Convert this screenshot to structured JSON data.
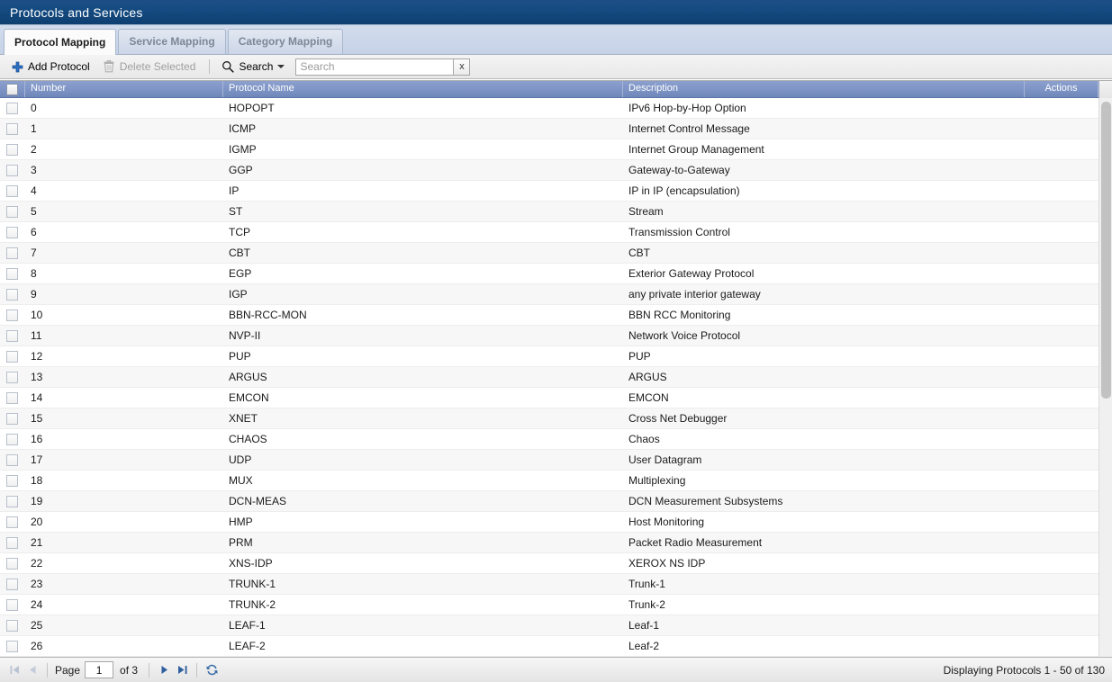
{
  "window": {
    "title": "Protocols and Services"
  },
  "tabs": [
    {
      "label": "Protocol Mapping",
      "active": true
    },
    {
      "label": "Service Mapping",
      "active": false
    },
    {
      "label": "Category Mapping",
      "active": false
    }
  ],
  "toolbar": {
    "add_label": "Add Protocol",
    "add_icon": "plus-icon",
    "delete_label": "Delete Selected",
    "delete_icon": "trash-icon",
    "delete_disabled": true,
    "search_menu_label": "Search",
    "search_menu_icon": "magnifier-icon",
    "search_value": "",
    "search_placeholder": "Search",
    "clear_label": "x"
  },
  "grid": {
    "columns": [
      "Number",
      "Protocol Name",
      "Description",
      "Actions"
    ],
    "rows": [
      {
        "number": "0",
        "name": "HOPOPT",
        "description": "IPv6 Hop-by-Hop Option"
      },
      {
        "number": "1",
        "name": "ICMP",
        "description": "Internet Control Message"
      },
      {
        "number": "2",
        "name": "IGMP",
        "description": "Internet Group Management"
      },
      {
        "number": "3",
        "name": "GGP",
        "description": "Gateway-to-Gateway"
      },
      {
        "number": "4",
        "name": "IP",
        "description": "IP in IP (encapsulation)"
      },
      {
        "number": "5",
        "name": "ST",
        "description": "Stream"
      },
      {
        "number": "6",
        "name": "TCP",
        "description": "Transmission Control"
      },
      {
        "number": "7",
        "name": "CBT",
        "description": "CBT"
      },
      {
        "number": "8",
        "name": "EGP",
        "description": "Exterior Gateway Protocol"
      },
      {
        "number": "9",
        "name": "IGP",
        "description": "any private interior gateway"
      },
      {
        "number": "10",
        "name": "BBN-RCC-MON",
        "description": "BBN RCC Monitoring"
      },
      {
        "number": "11",
        "name": "NVP-II",
        "description": "Network Voice Protocol"
      },
      {
        "number": "12",
        "name": "PUP",
        "description": "PUP"
      },
      {
        "number": "13",
        "name": "ARGUS",
        "description": "ARGUS"
      },
      {
        "number": "14",
        "name": "EMCON",
        "description": "EMCON"
      },
      {
        "number": "15",
        "name": "XNET",
        "description": "Cross Net Debugger"
      },
      {
        "number": "16",
        "name": "CHAOS",
        "description": "Chaos"
      },
      {
        "number": "17",
        "name": "UDP",
        "description": "User Datagram"
      },
      {
        "number": "18",
        "name": "MUX",
        "description": "Multiplexing"
      },
      {
        "number": "19",
        "name": "DCN-MEAS",
        "description": "DCN Measurement Subsystems"
      },
      {
        "number": "20",
        "name": "HMP",
        "description": "Host Monitoring"
      },
      {
        "number": "21",
        "name": "PRM",
        "description": "Packet Radio Measurement"
      },
      {
        "number": "22",
        "name": "XNS-IDP",
        "description": "XEROX NS IDP"
      },
      {
        "number": "23",
        "name": "TRUNK-1",
        "description": "Trunk-1"
      },
      {
        "number": "24",
        "name": "TRUNK-2",
        "description": "Trunk-2"
      },
      {
        "number": "25",
        "name": "LEAF-1",
        "description": "Leaf-1"
      },
      {
        "number": "26",
        "name": "LEAF-2",
        "description": "Leaf-2"
      }
    ]
  },
  "pager": {
    "first_icon": "first-page-icon",
    "prev_icon": "prev-page-icon",
    "next_icon": "next-page-icon",
    "last_icon": "last-page-icon",
    "refresh_icon": "refresh-icon",
    "page_label": "Page",
    "page_value": "1",
    "of_label": "of 3",
    "status": "Displaying Protocols 1 - 50 of 130"
  },
  "colors": {
    "title_bar": "#144a80",
    "grid_header": "#7f95c6",
    "accent_blue": "#2c5a9e",
    "row_alt": "#f7f7f7"
  }
}
